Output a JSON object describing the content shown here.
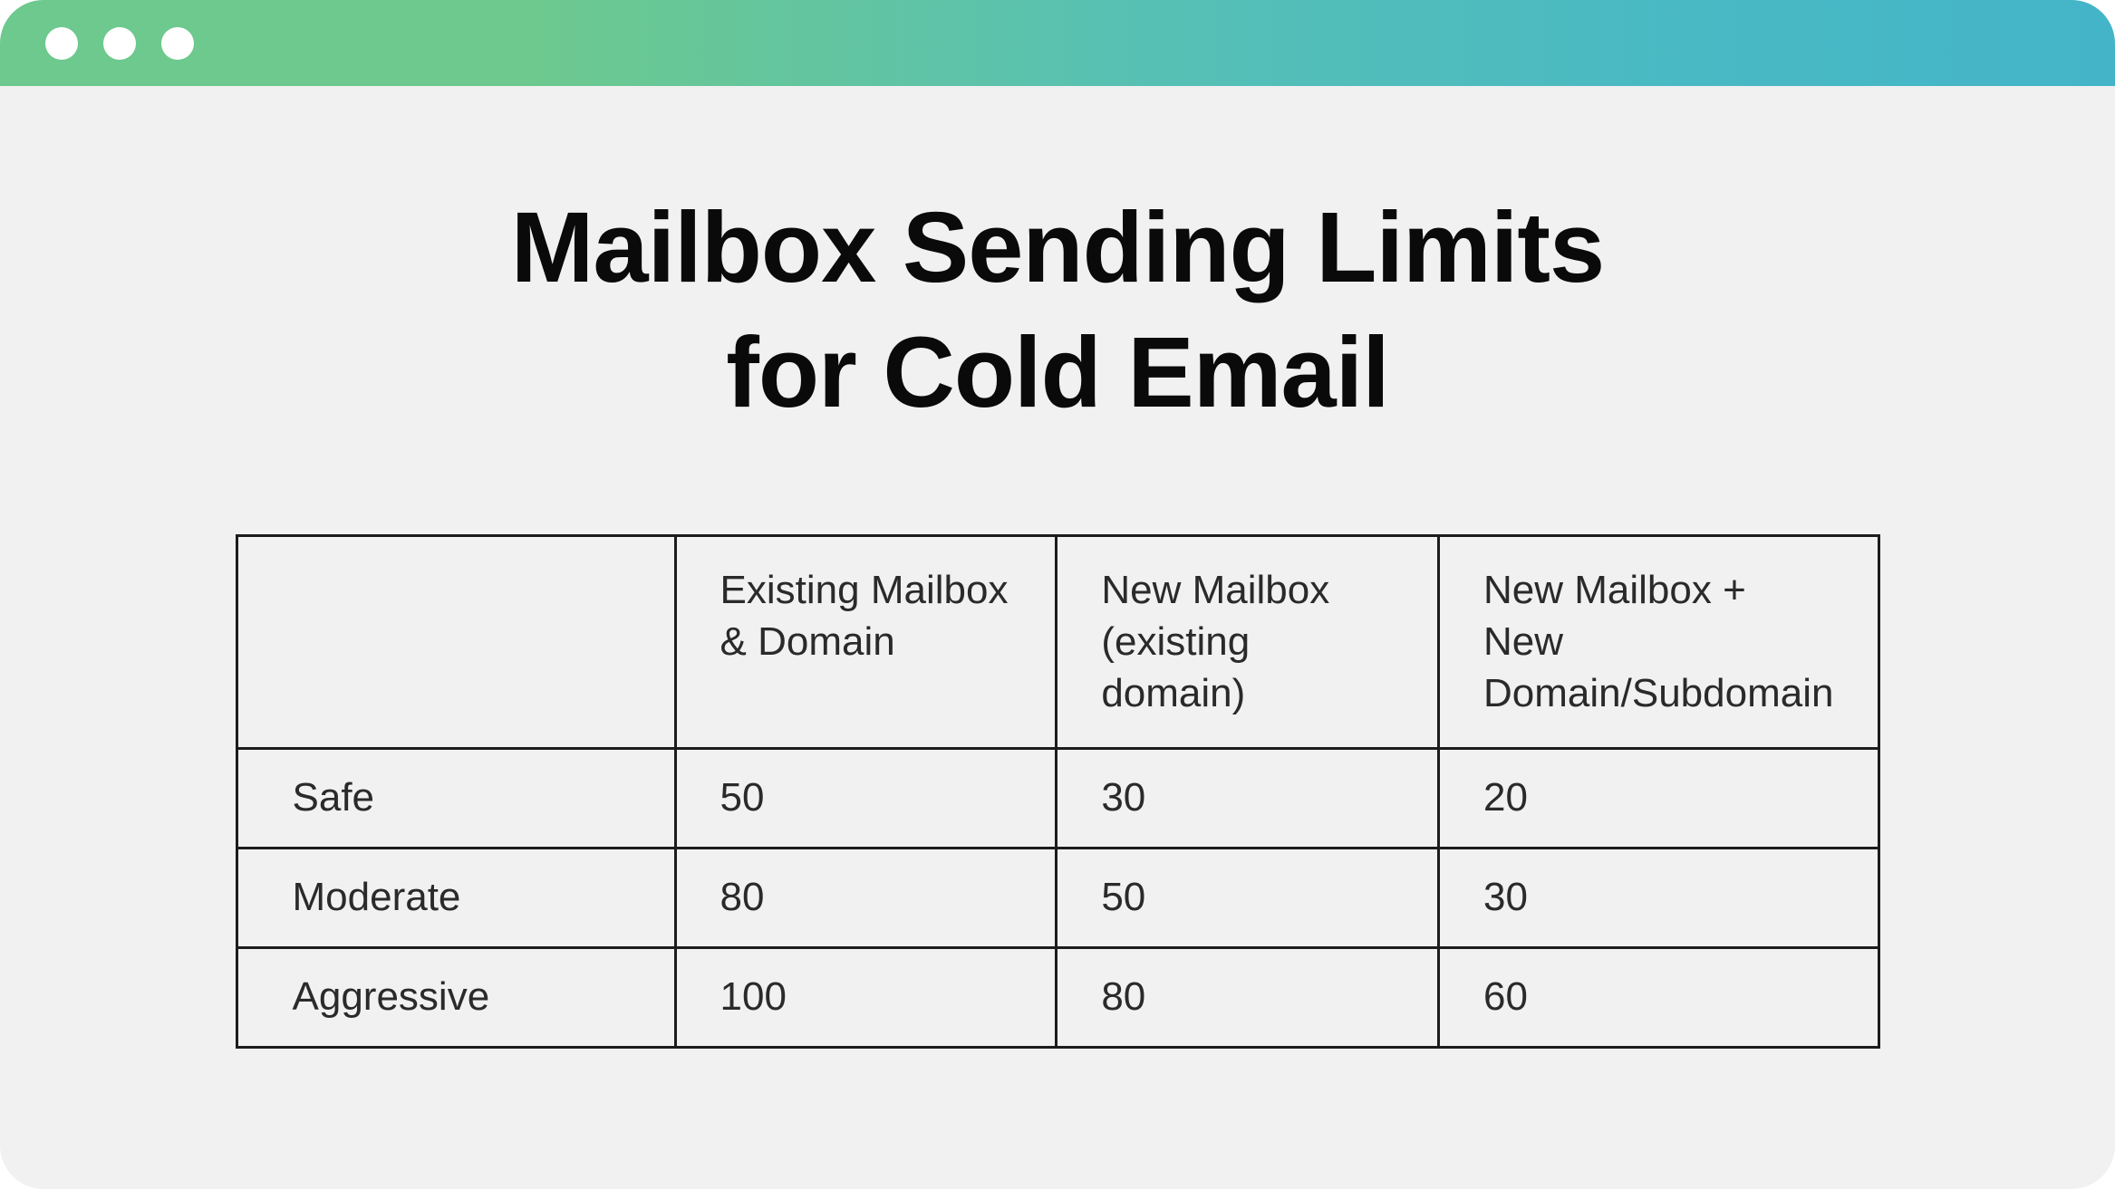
{
  "title_line1": "Mailbox Sending Limits",
  "title_line2": "for Cold Email",
  "chart_data": {
    "type": "table",
    "title": "Mailbox Sending Limits for Cold Email",
    "categories": [
      "Existing Mailbox & Domain",
      "New Mailbox (existing domain)",
      "New Mailbox + New Domain/Subdomain"
    ],
    "series": [
      {
        "name": "Safe",
        "values": [
          50,
          30,
          20
        ]
      },
      {
        "name": "Moderate",
        "values": [
          80,
          50,
          30
        ]
      },
      {
        "name": "Aggressive",
        "values": [
          100,
          80,
          60
        ]
      }
    ]
  },
  "table": {
    "headers": {
      "blank": "",
      "col1_line1": "Existing Mailbox",
      "col1_line2": "& Domain",
      "col2_line1": "New Mailbox",
      "col2_line2": "(existing domain)",
      "col3_line1": "New Mailbox + New",
      "col3_line2": "Domain/Subdomain"
    },
    "rows": [
      {
        "label": "Safe",
        "c1": "50",
        "c2": "30",
        "c3": "20"
      },
      {
        "label": "Moderate",
        "c1": "80",
        "c2": "50",
        "c3": "30"
      },
      {
        "label": "Aggressive",
        "c1": "100",
        "c2": "80",
        "c3": "60"
      }
    ]
  }
}
